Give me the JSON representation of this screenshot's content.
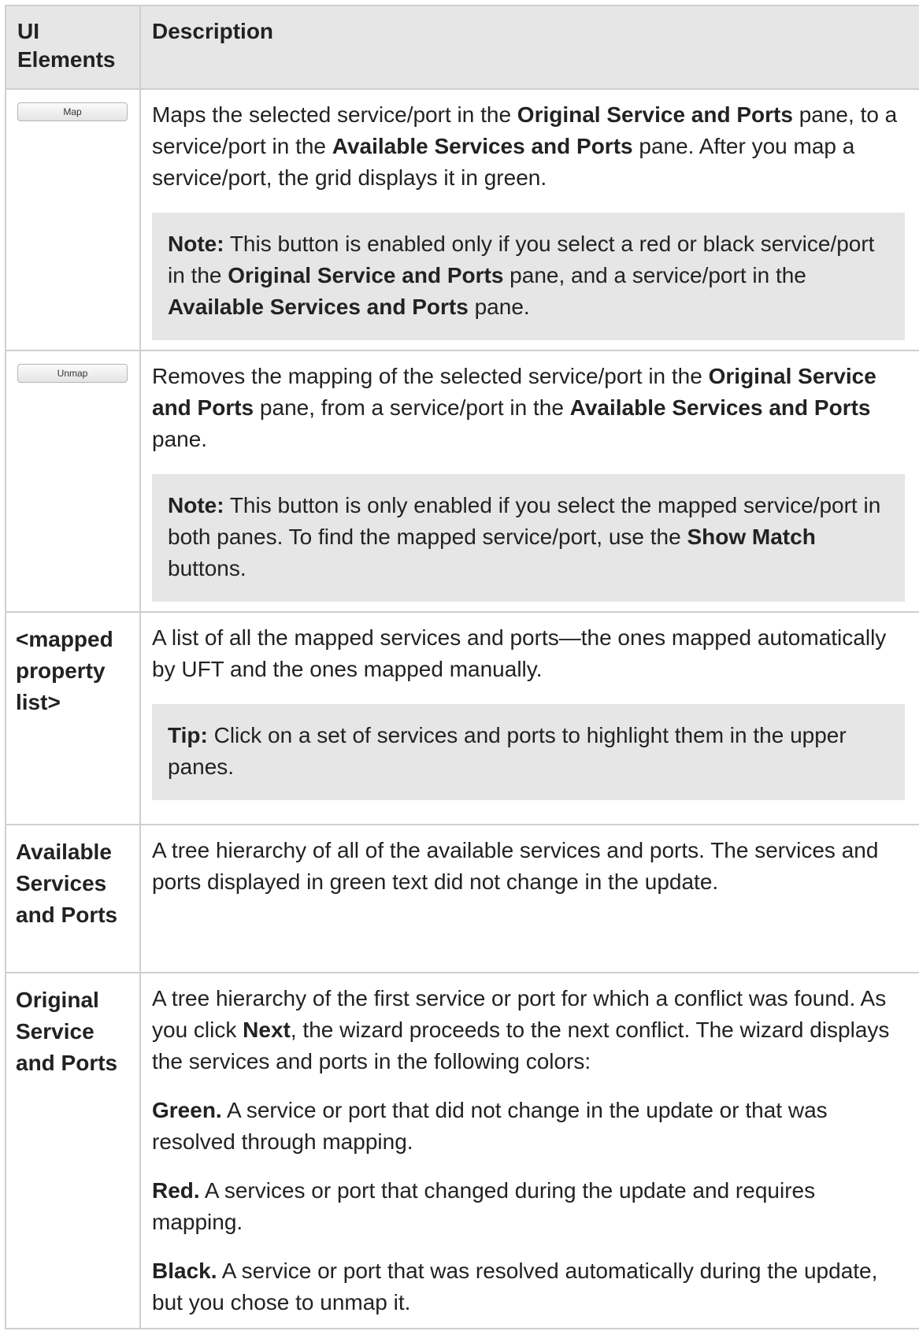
{
  "header": {
    "col1": "UI Elements",
    "col2": "Description"
  },
  "rows": {
    "map": {
      "button_label": "Map",
      "d1": "Maps the selected service/port in the ",
      "d2": "Original Service and Ports",
      "d3": " pane, to a service/port in the ",
      "d4": "Available Services and Ports",
      "d5": " pane. After you map a service/port, the grid displays it in green.",
      "note_label": "Note:",
      "n1": " This button is enabled only if you select a red or black service/port in the ",
      "n2": "Original Service and Ports",
      "n3": " pane, and a service/port in the ",
      "n4": "Available Services and Ports",
      "n5": " pane."
    },
    "unmap": {
      "button_label": "Unmap",
      "d1": "Removes the mapping of the selected service/port in the ",
      "d2": "Original Service and Ports",
      "d3": " pane, from a service/port in the ",
      "d4": "Available Services and Ports",
      "d5": " pane.",
      "note_label": "Note:",
      "n1": " This button is only enabled if you select the mapped service/port in both panes. To find the mapped service/port, use the ",
      "n2": "Show Match",
      "n3": " buttons."
    },
    "mapped_list": {
      "element": "<mapped property list>",
      "d1": "A list of all the mapped services and ports—the ones mapped automatically by UFT and the ones mapped manually.",
      "tip_label": "Tip:",
      "t1": " Click on a set of services and ports to highlight them in the upper panes."
    },
    "available": {
      "element": "Available Services and Ports",
      "d1": "A tree hierarchy of all of the available services and ports. The services and ports displayed in green text did not change in the update."
    },
    "original": {
      "element": "Original Service and Ports",
      "d1": "A tree hierarchy of the first service or port for which a conflict was found. As you click ",
      "d2": "Next",
      "d3": ", the wizard proceeds to the next conflict. The wizard displays the services and ports in the following colors:",
      "green_label": "Green.",
      "green_text": " A service or port that did not change in the update or that was resolved through mapping.",
      "red_label": "Red.",
      "red_text": " A services or port that changed during the update and requires mapping.",
      "black_label": "Black.",
      "black_text": " A service or port that was resolved automatically during the update, but you chose to unmap it."
    }
  }
}
